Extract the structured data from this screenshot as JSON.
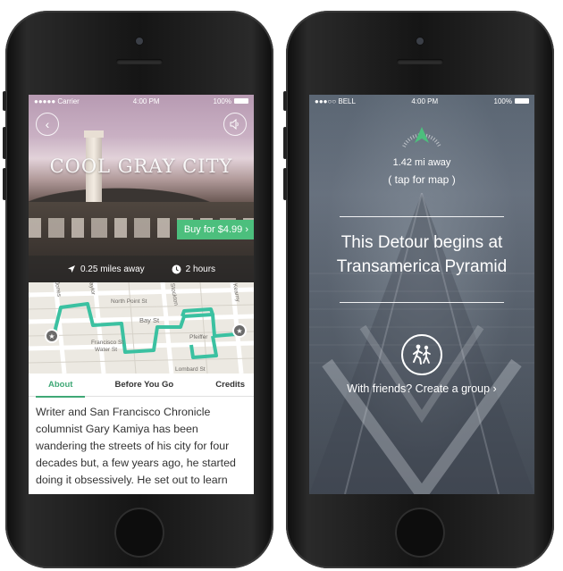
{
  "left": {
    "status": {
      "carrier": "●●●●● Carrier",
      "time": "4:00 PM",
      "battery": "100%"
    },
    "title": "COOL GRAY CITY",
    "buy_label": "Buy for $4.99 ›",
    "distance": "0.25 miles away",
    "duration": "2 hours",
    "map_labels": {
      "north_point": "North Point St",
      "bay": "Bay St",
      "francisco": "Francisco St",
      "water": "Water St",
      "pfeiffer": "Pfeiffer",
      "jones": "Jones",
      "taylor": "Taylor",
      "stockton": "Stockton",
      "kearny": "Kearny",
      "lombard": "Lombard St"
    },
    "tabs": [
      {
        "label": "About",
        "active": true
      },
      {
        "label": "Before You Go",
        "active": false
      },
      {
        "label": "Credits",
        "active": false
      }
    ],
    "description": "Writer and San Francisco Chronicle columnist Gary Kamiya has been wandering the streets of his city for four decades but, a few years ago, he started doing it obsessively.  He set out to learn",
    "accent_color": "#4cbf7d"
  },
  "right": {
    "status": {
      "carrier": "●●●○○ BELL",
      "time": "4:00 PM",
      "battery": "100%"
    },
    "distance": "1.42 mi away",
    "tap_for_map": "tap for map",
    "headline_line1": "This Detour begins at",
    "headline_line2": "Transamerica Pyramid",
    "friends_label": "With friends? Create a group ›",
    "arrow_color": "#4cbf7d"
  }
}
